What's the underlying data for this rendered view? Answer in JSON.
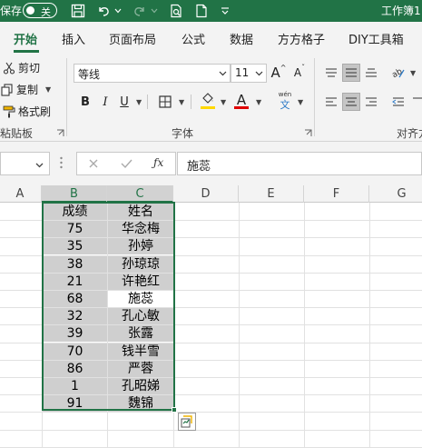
{
  "titlebar": {
    "autosave_label": "保存",
    "autosave_state": "关",
    "doc_title": "工作簿1"
  },
  "tabs": [
    "开始",
    "插入",
    "页面布局",
    "公式",
    "数据",
    "方方格子",
    "DIY工具箱"
  ],
  "clipboard": {
    "cut": "剪切",
    "copy": "复制",
    "format_painter": "格式刷",
    "group_label": "粘贴板"
  },
  "font": {
    "name": "等线",
    "size": "11",
    "group_label": "字体",
    "underline_color": "#e00000",
    "highlight_color": "#ffd800",
    "wen_label": "wén",
    "wen_char": "文"
  },
  "alignment": {
    "group_label": "对齐方"
  },
  "formula_bar": {
    "value": "施蕊"
  },
  "columns": [
    "A",
    "B",
    "C",
    "D",
    "E",
    "F",
    "G"
  ],
  "table": {
    "headers": [
      "成绩",
      "姓名"
    ],
    "rows": [
      [
        "75",
        "华念梅"
      ],
      [
        "35",
        "孙婷"
      ],
      [
        "38",
        "孙琼琼"
      ],
      [
        "21",
        "许艳红"
      ],
      [
        "68",
        "施蕊"
      ],
      [
        "32",
        "孔心敏"
      ],
      [
        "39",
        "张露"
      ],
      [
        "70",
        "钱半雪"
      ],
      [
        "86",
        "严蓉"
      ],
      [
        "1",
        "孔昭娣"
      ],
      [
        "91",
        "魏锦"
      ]
    ]
  },
  "colors": {
    "accent": "#217346",
    "selection_fill": "#cfcfcf"
  }
}
